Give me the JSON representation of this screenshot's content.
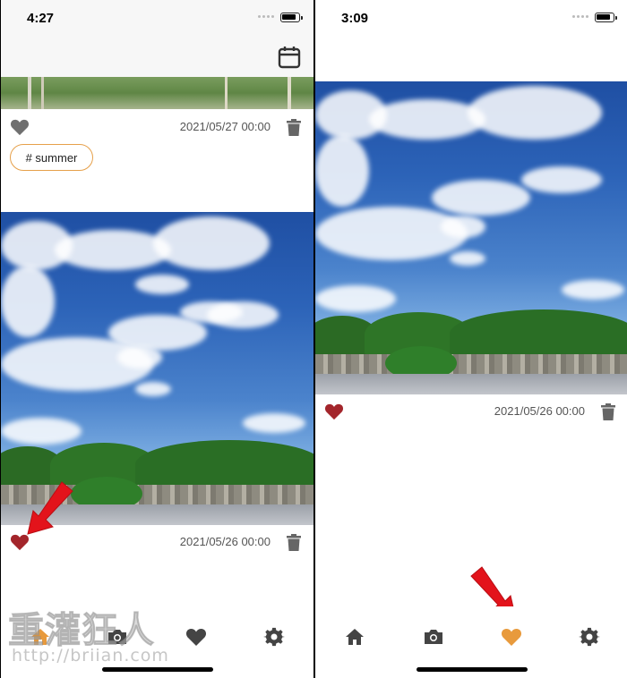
{
  "left_screen": {
    "status_time": "4:27",
    "posts": [
      {
        "date": "2021/05/27 00:00",
        "liked": false,
        "tag": "# summer"
      },
      {
        "date": "2021/05/26 00:00",
        "liked": true
      }
    ],
    "tabs": [
      {
        "icon": "home-icon",
        "active": true
      },
      {
        "icon": "camera-icon",
        "active": false
      },
      {
        "icon": "heart-icon",
        "active": false
      },
      {
        "icon": "gear-icon",
        "active": false
      }
    ]
  },
  "right_screen": {
    "status_time": "3:09",
    "posts": [
      {
        "date": "2021/05/26 00:00",
        "liked": true
      }
    ],
    "tabs": [
      {
        "icon": "home-icon",
        "active": false
      },
      {
        "icon": "camera-icon",
        "active": false
      },
      {
        "icon": "heart-icon",
        "active": true
      },
      {
        "icon": "gear-icon",
        "active": false
      }
    ]
  },
  "watermark": {
    "text": "重灌狂人",
    "url": "http://briian.com"
  },
  "colors": {
    "liked_heart": "#a3252b",
    "unliked_heart": "#6f6f6f",
    "active_tab": "#e89a3c",
    "tab_icon": "#444444",
    "arrow": "#e3131b",
    "tag_border": "#e6a04a"
  }
}
